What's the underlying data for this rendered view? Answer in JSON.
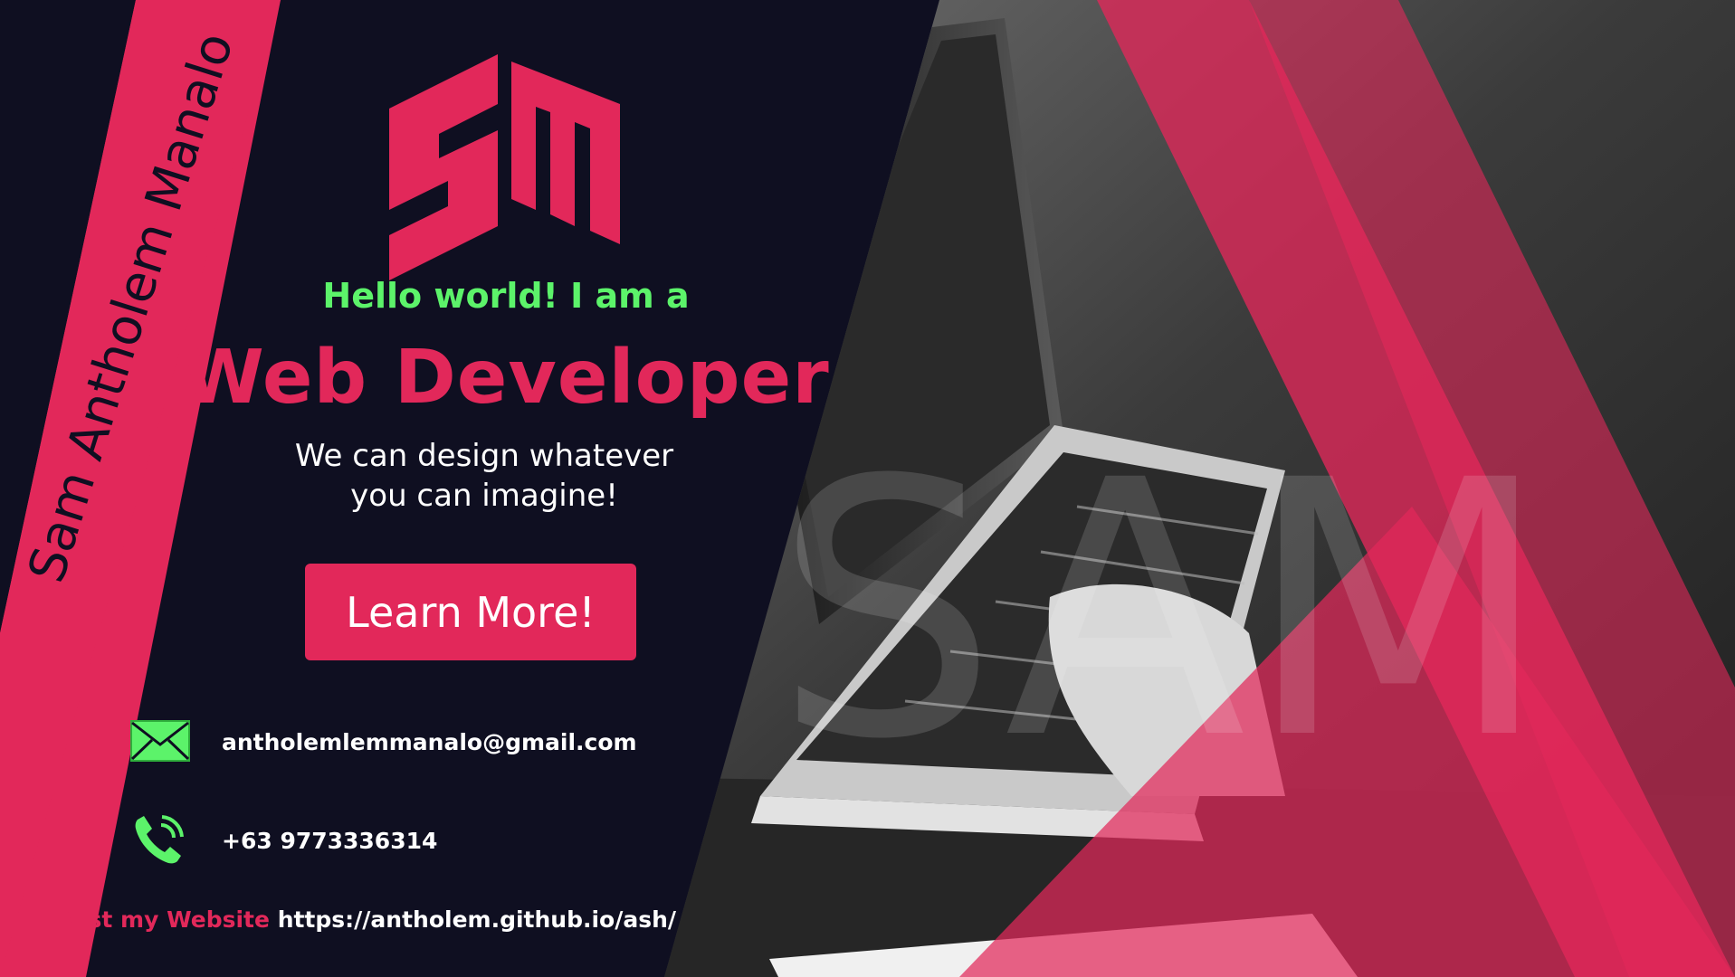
{
  "profile": {
    "vertical_name": "Sam Antholem Manalo",
    "logo_text": "SM",
    "watermark_text": "SAM"
  },
  "hero": {
    "greeting": "Hello world! I am a",
    "title": "Web Developer",
    "tagline_line1": "We can design whatever",
    "tagline_line2": "you can imagine!",
    "cta_label": "Learn More!"
  },
  "contact": {
    "email": "antholemlemmanalo@gmail.com",
    "phone": "+63 9773336314",
    "email_icon": "envelope-icon",
    "phone_icon": "phone-icon"
  },
  "footer": {
    "website_label": "Vist my Website",
    "website_url": "https://antholem.github.io/ash/"
  },
  "colors": {
    "background": "#0f0f21",
    "accent": "#e2285a",
    "highlight": "#5cf36a",
    "text": "#ffffff"
  }
}
